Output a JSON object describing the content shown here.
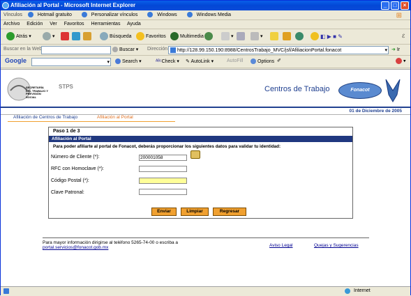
{
  "window": {
    "title": "Afiliación al Portal - Microsoft Internet Explorer"
  },
  "links_bar": {
    "label": "Vínculos",
    "items": [
      "Hotmail gratuito",
      "Personalizar vínculos",
      "Windows",
      "Windows Media"
    ]
  },
  "menu": [
    "Archivo",
    "Edición",
    "Ver",
    "Favoritos",
    "Herramientas",
    "Ayuda"
  ],
  "toolbar": {
    "back": "Atrás",
    "search": "Búsqueda",
    "favorites": "Favoritos",
    "multimedia": "Multimedia"
  },
  "addressbar": {
    "search_label": "Buscar en la Web",
    "search_button": "Buscar",
    "address_label": "Dirección",
    "url": "http://128.99.150.190:8988/CentrosTrabajo_MVC/jsf/AfiliacionPortal.fonacot",
    "go": "Ir"
  },
  "googlebar": {
    "brand": "Google",
    "search": "Search",
    "check": "Check",
    "autolink": "AutoLink",
    "autofill": "AutoFill",
    "options": "Options"
  },
  "header": {
    "logo_text": "SECRETARÍA DEL TRABAJO Y PREVISIÓN SOCIAL",
    "logo_abbr": "STPS",
    "site_title": "Centros de Trabajo",
    "brand": "Fonacot",
    "date": "01 de Diciembre de 2005"
  },
  "nav": {
    "item1": "Afiliación de Centros de Trabajo",
    "item2": "Afiliación al Portal"
  },
  "form": {
    "step": "Paso 1 de 3",
    "section_title": "Afiliación al Portal",
    "instructions": "Para poder afiliarte al portal de Fonacot, deberás proporcionar los siguientes datos para validar tu identidad:",
    "fields": [
      {
        "label": "Número de Cliente (*):",
        "value": "200001058"
      },
      {
        "label": "RFC con Homoclave (*):",
        "value": ""
      },
      {
        "label": "Código Postal (*):",
        "value": ""
      },
      {
        "label": "Clave Patronal:",
        "value": ""
      }
    ],
    "buttons": {
      "submit": "Enviar",
      "clear": "Limpiar",
      "back": "Regresar"
    }
  },
  "footer": {
    "info": "Para mayor información dirigirse al teléfono 5265-74-00 o escriba a",
    "email": "portal.servicios@fonacot.gob.mx",
    "legal": "Aviso Legal",
    "complaints": "Quejas y Sugerencias"
  },
  "status": {
    "zone": "Internet"
  }
}
